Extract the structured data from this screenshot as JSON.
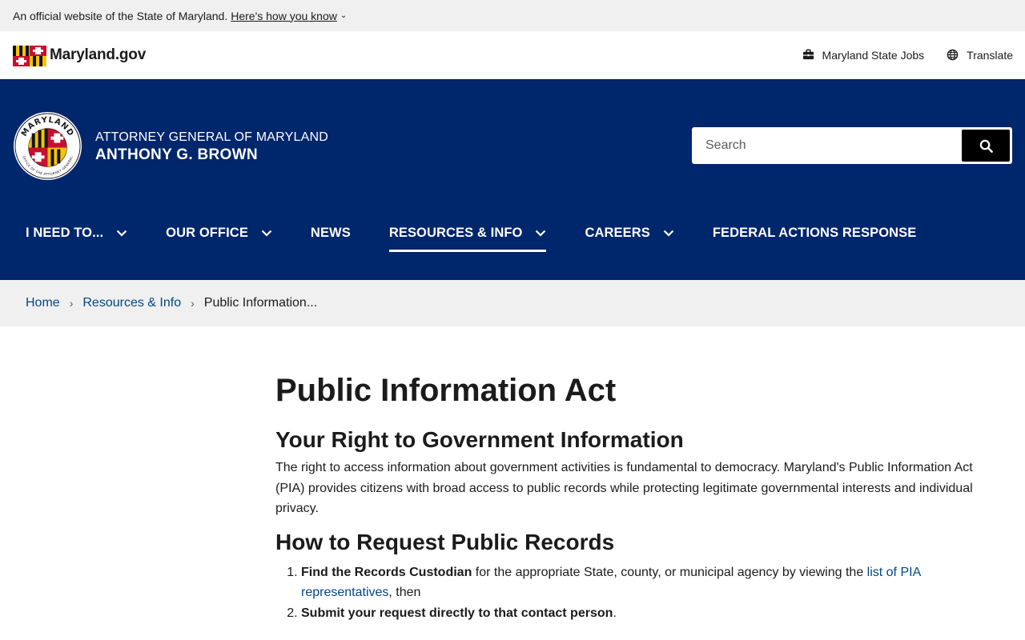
{
  "banner": {
    "text": "An official website of the State of Maryland.",
    "link": "Here's how you know",
    "chevron": "⌄"
  },
  "utility": {
    "logo_text": "Maryland.gov",
    "jobs": "Maryland State Jobs",
    "translate": "Translate"
  },
  "agency": {
    "line1": "ATTORNEY GENERAL OF MARYLAND",
    "line2": "ANTHONY G. BROWN",
    "seal_top": "MARYLAND",
    "seal_bottom": "OFFICE OF THE ATTORNEY GENERAL"
  },
  "search": {
    "placeholder": "Search"
  },
  "nav": [
    {
      "label": "I NEED TO...",
      "dropdown": true,
      "active": false
    },
    {
      "label": "OUR OFFICE",
      "dropdown": true,
      "active": false
    },
    {
      "label": "NEWS",
      "dropdown": false,
      "active": false
    },
    {
      "label": "RESOURCES & INFO",
      "dropdown": true,
      "active": true
    },
    {
      "label": "CAREERS",
      "dropdown": true,
      "active": false
    },
    {
      "label": "FEDERAL ACTIONS RESPONSE",
      "dropdown": false,
      "active": false
    }
  ],
  "breadcrumb": {
    "home": "Home",
    "section": "Resources & Info",
    "current": "Public Information..."
  },
  "content": {
    "title": "Public Information Act",
    "h2_right": "Your Right to Government Information",
    "paragraph": "The right to access information about government activities is fundamental to democracy. Maryland's Public Information Act (PIA) provides citizens with broad access to public records while protecting legitimate governmental interests and individual privacy.",
    "h2_request": "How to Request Public Records",
    "steps": [
      {
        "bold": "Find the Records Custodian",
        "text": " for the appropriate State, county, or municipal agency by viewing the ",
        "link": "list of PIA representatives",
        "after": ", then"
      },
      {
        "bold": "Submit your request directly to that contact person",
        "text": "."
      }
    ]
  },
  "colors": {
    "brand_navy": "#00266b",
    "link": "#00468b",
    "banner_bg": "#f0f0f0"
  }
}
